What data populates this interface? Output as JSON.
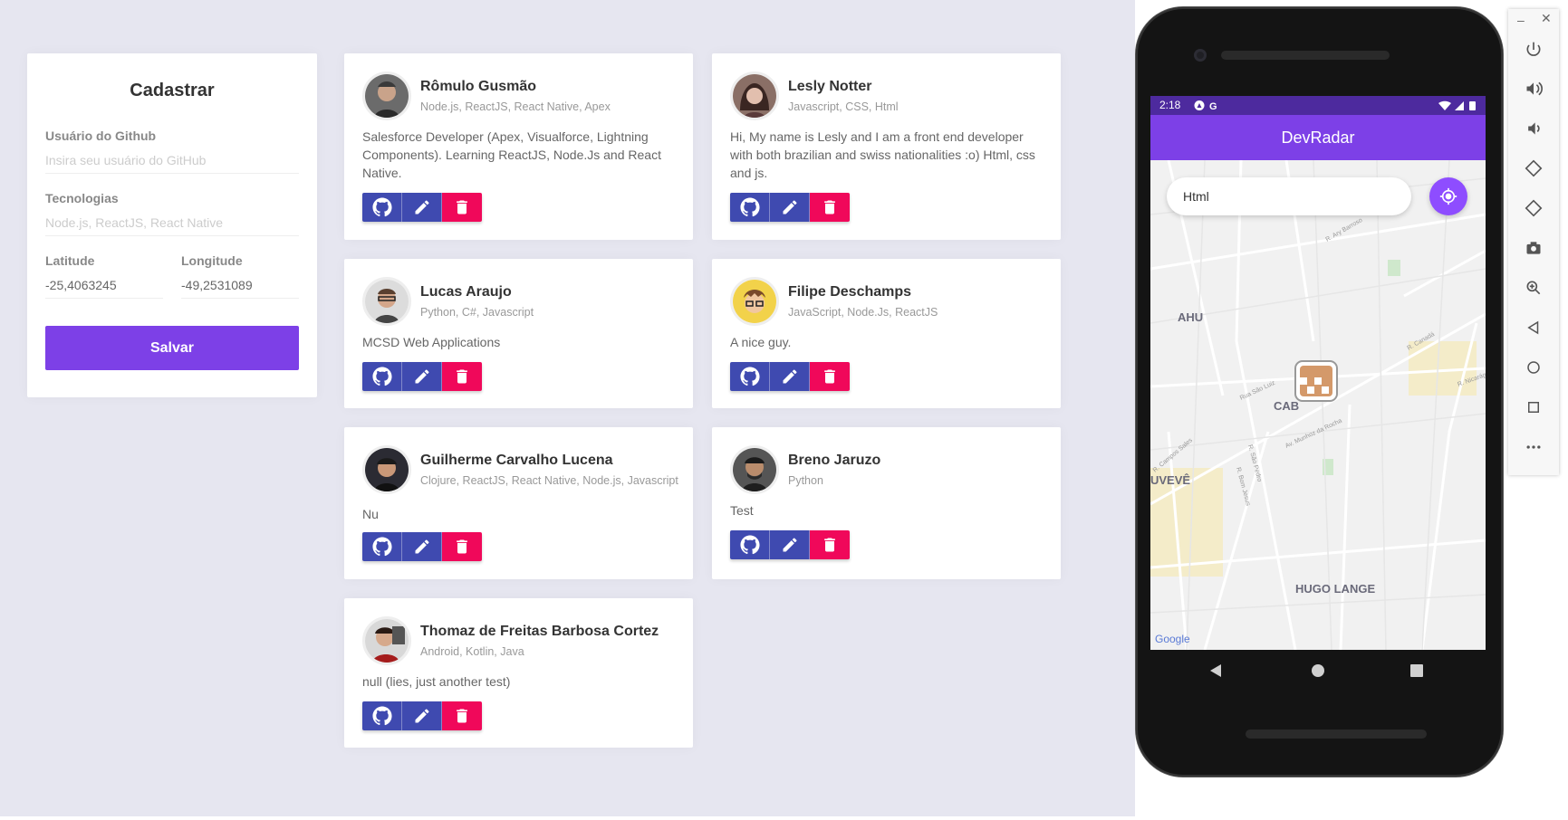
{
  "form": {
    "title": "Cadastrar",
    "github_label": "Usuário do Github",
    "github_placeholder": "Insira seu usuário do GitHub",
    "techs_label": "Tecnologias",
    "techs_placeholder": "Node.js, ReactJS, React Native",
    "latitude_label": "Latitude",
    "latitude_value": "-25,4063245",
    "longitude_label": "Longitude",
    "longitude_value": "-49,2531089",
    "save_label": "Salvar"
  },
  "devs": [
    {
      "name": "Rômulo Gusmão",
      "techs": "Node.js, ReactJS, React Native, Apex",
      "bio": "Salesforce Developer (Apex, Visualforce, Lightning Components). Learning ReactJS, Node.Js and React Native."
    },
    {
      "name": "Lesly Notter",
      "techs": "Javascript, CSS, Html",
      "bio": "Hi, My name is Lesly and I am a front end developer with both brazilian and swiss nationalities :o) Html, css and js."
    },
    {
      "name": "Lucas Araujo",
      "techs": "Python, C#, Javascript",
      "bio": "MCSD Web Applications"
    },
    {
      "name": "Filipe Deschamps",
      "techs": "JavaScript, Node.Js, ReactJS",
      "bio": "A nice guy."
    },
    {
      "name": "Guilherme Carvalho Lucena",
      "techs": "Clojure, ReactJS, React Native, Node.js, Javascript",
      "bio": "Nu"
    },
    {
      "name": "Breno Jaruzo",
      "techs": "Python",
      "bio": "Test"
    },
    {
      "name": "Thomaz de Freitas Barbosa Cortez",
      "techs": "Android, Kotlin, Java",
      "bio": "null (lies, just another test)"
    }
  ],
  "mobile": {
    "time": "2:18",
    "app_title": "DevRadar",
    "search_value": "Html",
    "map_labels": {
      "ahu": "AHU",
      "cabral": "CAB",
      "juveve": "UVEVÊ",
      "hugo_lange": "HUGO LANGE",
      "google": "Google",
      "r_ary_barroso": "R. Ary Barroso",
      "r_sao_luiz": "Rua São Luiz",
      "av_munhoz": "Av. Munhoz da Rocha",
      "r_sao_pedro": "R. São Pedro",
      "r_canada": "R. Canadá",
      "r_nicaragua": "R. Nicarágua",
      "r_campos_sales": "R. Campos Sales",
      "r_bom_jesus": "R. Bom Jesus"
    }
  },
  "colors": {
    "primary": "#7d40e7",
    "action_blue": "#3f4ab0",
    "action_red": "#f0085a",
    "background": "#e6e6f0"
  },
  "icons": {
    "github": "github-icon",
    "edit": "pencil-icon",
    "delete": "trash-icon",
    "locate": "crosshair-icon"
  }
}
